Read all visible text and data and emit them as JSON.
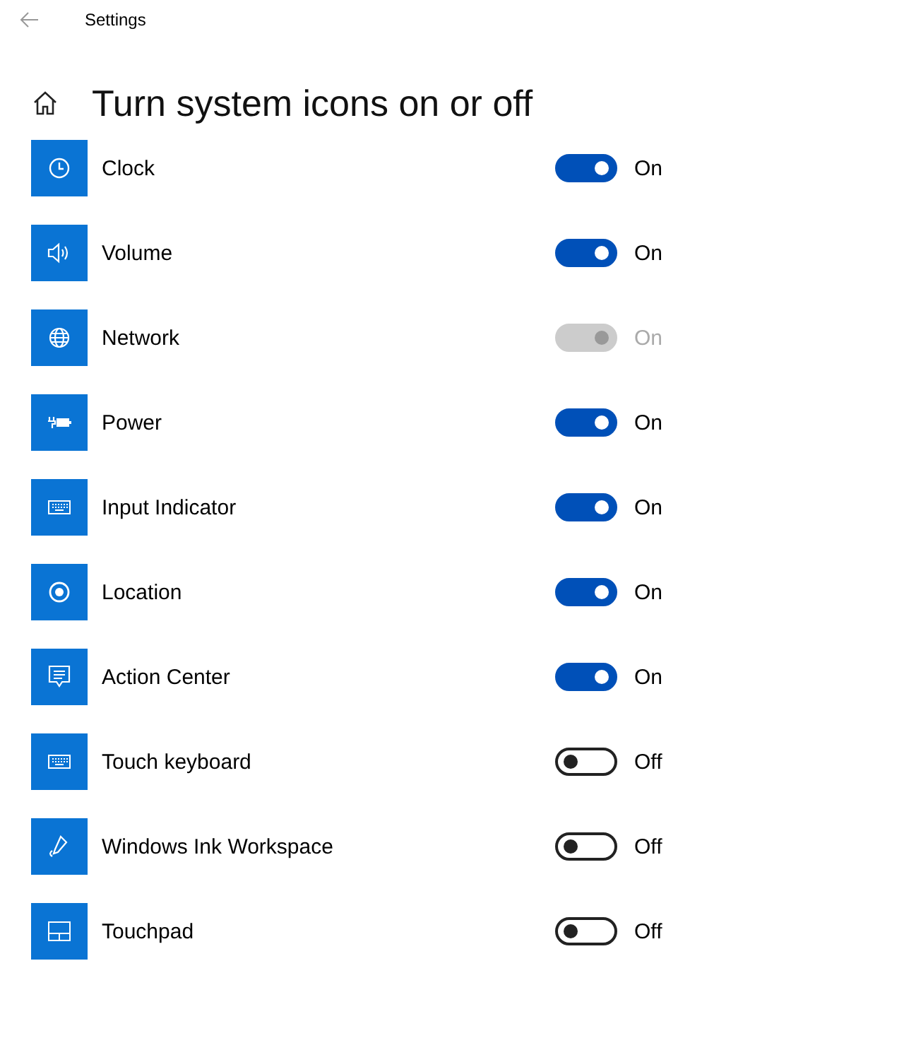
{
  "window": {
    "title": "Settings"
  },
  "page": {
    "title": "Turn system icons on or off"
  },
  "items": [
    {
      "kind": "clock",
      "label": "Clock",
      "on": true,
      "disabled": false,
      "state_text": "On"
    },
    {
      "kind": "volume",
      "label": "Volume",
      "on": true,
      "disabled": false,
      "state_text": "On"
    },
    {
      "kind": "network",
      "label": "Network",
      "on": true,
      "disabled": true,
      "state_text": "On"
    },
    {
      "kind": "power",
      "label": "Power",
      "on": true,
      "disabled": false,
      "state_text": "On"
    },
    {
      "kind": "keyboard",
      "label": "Input Indicator",
      "on": true,
      "disabled": false,
      "state_text": "On"
    },
    {
      "kind": "location",
      "label": "Location",
      "on": true,
      "disabled": false,
      "state_text": "On"
    },
    {
      "kind": "message",
      "label": "Action Center",
      "on": true,
      "disabled": false,
      "state_text": "On"
    },
    {
      "kind": "keyboard",
      "label": "Touch keyboard",
      "on": false,
      "disabled": false,
      "state_text": "Off"
    },
    {
      "kind": "pen",
      "label": "Windows Ink Workspace",
      "on": false,
      "disabled": false,
      "state_text": "Off"
    },
    {
      "kind": "touchpad",
      "label": "Touchpad",
      "on": false,
      "disabled": false,
      "state_text": "Off"
    }
  ]
}
